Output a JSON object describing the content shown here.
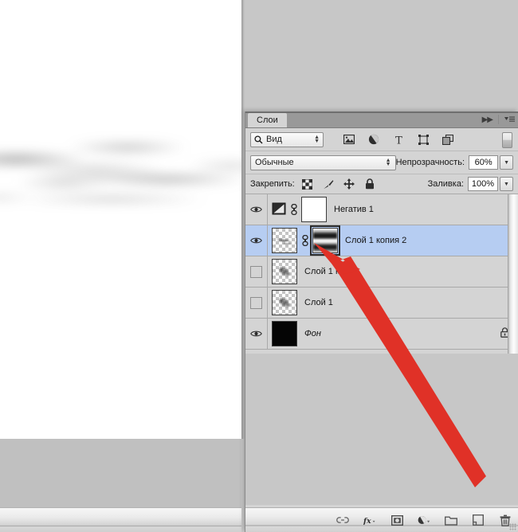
{
  "app": {
    "panel_title": "Слои",
    "collapse_icon": "double-chevron-right-icon",
    "menu_icon": "panel-menu-icon"
  },
  "filter_row": {
    "kind_label": "Вид",
    "search_icon": "magnifier-icon",
    "icons": [
      {
        "name": "pixel-layer-filter-icon",
        "title": "pixel"
      },
      {
        "name": "adjustment-layer-filter-icon",
        "title": "adjustment"
      },
      {
        "name": "type-layer-filter-icon",
        "title": "T"
      },
      {
        "name": "shape-layer-filter-icon",
        "title": "shape"
      },
      {
        "name": "smart-object-filter-icon",
        "title": "smart object"
      }
    ],
    "toggle_name": "filter-enable-toggle"
  },
  "blend_row": {
    "blend_mode": "Обычные",
    "opacity_label": "Непрозрачность:",
    "opacity_value": "60%",
    "fill_label": "Заливка:",
    "fill_value": "100%"
  },
  "lock_row": {
    "label": "Закрепить:",
    "icons": [
      {
        "name": "lock-transparent-pixels-icon"
      },
      {
        "name": "lock-image-pixels-icon"
      },
      {
        "name": "lock-position-icon"
      },
      {
        "name": "lock-all-icon"
      }
    ]
  },
  "layers": [
    {
      "name": "Негатив 1",
      "visible": true,
      "selected": false,
      "italic": false,
      "locked": false,
      "thumb_kind": "adjustment-invert",
      "has_link": true,
      "mask_kind": "white",
      "mask_selected": false
    },
    {
      "name": "Слой 1 копия 2",
      "visible": true,
      "selected": true,
      "italic": false,
      "locked": false,
      "thumb_kind": "checker-streak",
      "has_link": true,
      "mask_kind": "stripes",
      "mask_selected": true
    },
    {
      "name": "Слой 1 копия",
      "visible": false,
      "selected": false,
      "italic": false,
      "locked": false,
      "thumb_kind": "checker-blob",
      "has_link": false,
      "mask_kind": null,
      "mask_selected": false
    },
    {
      "name": "Слой 1",
      "visible": false,
      "selected": false,
      "italic": false,
      "locked": false,
      "thumb_kind": "checker-blob",
      "has_link": false,
      "mask_kind": null,
      "mask_selected": false
    },
    {
      "name": "Фон",
      "visible": true,
      "selected": false,
      "italic": true,
      "locked": true,
      "thumb_kind": "black",
      "has_link": false,
      "mask_kind": null,
      "mask_selected": false
    }
  ],
  "bottom_bar": {
    "buttons": [
      {
        "name": "link-layers-button",
        "label": "link"
      },
      {
        "name": "layer-style-fx-button",
        "label": "fx"
      },
      {
        "name": "add-layer-mask-button",
        "label": "mask"
      },
      {
        "name": "new-fill-adjustment-layer-button",
        "label": "adjustment"
      },
      {
        "name": "new-group-button",
        "label": "group"
      },
      {
        "name": "new-layer-button",
        "label": "new layer"
      },
      {
        "name": "delete-layer-button",
        "label": "delete"
      }
    ]
  },
  "colors": {
    "panel_bg": "#d4d4d4",
    "selected_row": "#b6cdf2",
    "tab_bar": "#999999",
    "annotation_arrow": "#e03127",
    "canvas": "#ffffff"
  }
}
